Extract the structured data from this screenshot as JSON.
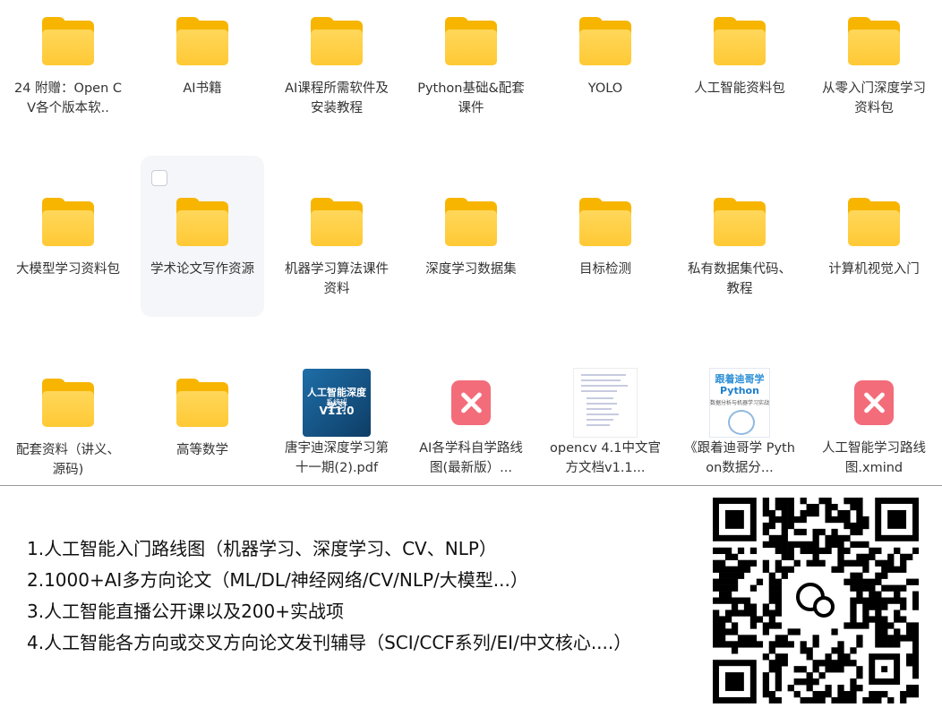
{
  "files": [
    {
      "name": "24 附赠：Open CV各个版本软..",
      "type": "folder"
    },
    {
      "name": "AI书籍",
      "type": "folder"
    },
    {
      "name": "AI课程所需软件及安装教程",
      "type": "folder"
    },
    {
      "name": "Python基础&配套课件",
      "type": "folder"
    },
    {
      "name": "YOLO",
      "type": "folder"
    },
    {
      "name": "人工智能资料包",
      "type": "folder"
    },
    {
      "name": "从零入门深度学习资料包",
      "type": "folder"
    },
    {
      "name": "大模型学习资料包",
      "type": "folder"
    },
    {
      "name": "学术论文写作资源",
      "type": "folder"
    },
    {
      "name": "机器学习算法课件资料",
      "type": "folder"
    },
    {
      "name": "深度学习数据集",
      "type": "folder"
    },
    {
      "name": "目标检测",
      "type": "folder"
    },
    {
      "name": "私有数据集代码、教程",
      "type": "folder"
    },
    {
      "name": "计算机视觉入门",
      "type": "folder"
    },
    {
      "name": "配套资料（讲义、源码)",
      "type": "folder"
    },
    {
      "name": "高等数学",
      "type": "folder"
    },
    {
      "name": "唐宇迪深度学习第十一期(2).pdf",
      "type": "pdf"
    },
    {
      "name": "AI各学科自学路线图(最新版）...",
      "type": "xmind"
    },
    {
      "name": "opencv 4.1中文官方文档v1.1...",
      "type": "doc"
    },
    {
      "name": "《跟着迪哥学 Python数据分...",
      "type": "book"
    },
    {
      "name": "人工智能学习路线图.xmind",
      "type": "xmind"
    }
  ],
  "pdf_cover": {
    "line1": "人工智能深度学习",
    "line2": "系统班",
    "line3": "V11.0"
  },
  "book_cover": {
    "line1": "跟着迪哥学",
    "line2": "Python",
    "line3": "数据分析与机器学习实战"
  },
  "promo": {
    "line1": "1.人工智能入门路线图（机器学习、深度学习、CV、NLP）",
    "line2": "2.1000+AI多方向论文（ML/DL/神经网络/CV/NLP/大模型...）",
    "line3": "3.人工智能直播公开课以及200+实战项",
    "line4": "4.人工智能各方向或交叉方向论文发刊辅导（SCI/CCF系列/EI/中文核心....）"
  },
  "colors": {
    "folder": "#ffc935",
    "xmind": "#f36c7a",
    "hover": "#f5f6f9"
  }
}
